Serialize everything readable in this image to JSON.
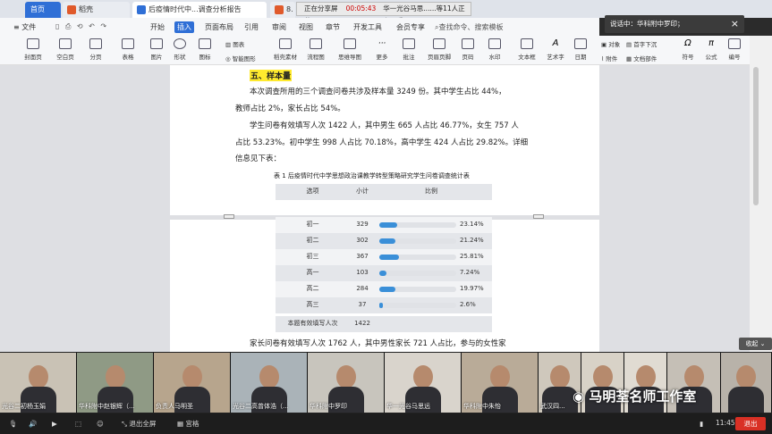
{
  "tabs": [
    {
      "label": "首页",
      "color": "#2f6fd6",
      "active": false
    },
    {
      "label": "稻壳",
      "color": "#e05a2b",
      "active": false
    },
    {
      "label": "后疫情时代中...调查分析报告",
      "color": "#2f6fd6",
      "active": true
    },
    {
      "label": "8.",
      "color": "#e05a2b",
      "active": false
    }
  ],
  "share_status": {
    "label": "正在分享屏幕",
    "time": "00:05:43",
    "viewers": "华一光谷马思......等11人正在观看"
  },
  "popup": {
    "text": "说话中：华科附中罗印；",
    "close": "×"
  },
  "menu": [
    "文件",
    "开始",
    "插入",
    "页面布局",
    "引用",
    "审阅",
    "视图",
    "章节",
    "开发工具",
    "会员专享"
  ],
  "menu_active_index": 2,
  "search_label": "查找命令、搜索模板",
  "ribbon": [
    "封面页",
    "空白页",
    "分页",
    "表格",
    "图片",
    "形状",
    "图标",
    "智能图形",
    "稻壳素材",
    "流程图",
    "思维导图",
    "更多",
    "批注",
    "页眉页脚",
    "页码",
    "水印",
    "文本框",
    "艺术字",
    "日期",
    "附件",
    "文档部件",
    "符号",
    "公式",
    "编号"
  ],
  "ribbon_small": {
    "chart": "图表",
    "object": "对象",
    "dropcap": "首字下沉"
  },
  "document": {
    "heading": "五、样本量",
    "para1_line1": "本次调查所用的三个调查问卷共涉及样本量 3249 份。其中学生占比 44%，",
    "para1_line2": "教师占比 2%，家长占比 54%。",
    "para2_line1": "学生问卷有效填写人次 1422 人，其中男生 665 人占比 46.77%，女生 757 人",
    "para2_line2": "占比 53.23%。初中学生 998 人占比 70.18%，高中学生 424 人占比 29.82%。详细",
    "para2_line3": "信息见下表：",
    "caption": "表 1   后疫情时代中学思想政治课教学转型策略研究学生问卷调查统计表",
    "para3": "家长问卷有效填写人次 1762 人，其中男性家长 721 人占比，参与的女性家"
  },
  "table": {
    "headers": [
      "选项",
      "小计",
      "比例"
    ],
    "rows": [
      {
        "option": "初一",
        "count": "329",
        "pct": "23.14%",
        "ratio": 0.2314
      },
      {
        "option": "初二",
        "count": "302",
        "pct": "21.24%",
        "ratio": 0.2124
      },
      {
        "option": "初三",
        "count": "367",
        "pct": "25.81%",
        "ratio": 0.2581
      },
      {
        "option": "高一",
        "count": "103",
        "pct": "7.24%",
        "ratio": 0.0724
      },
      {
        "option": "高二",
        "count": "284",
        "pct": "19.97%",
        "ratio": 0.1997
      },
      {
        "option": "高三",
        "count": "37",
        "pct": "2.6%",
        "ratio": 0.026
      }
    ],
    "footer_label": "本题有效填写人次",
    "footer_value": "1422"
  },
  "collapse_label": "收起",
  "participants": [
    "光谷二初杨玉娟",
    "华科附中赵银辉（...",
    "负责人马明圣",
    "光谷二高曾体浩（...",
    "华科附中罗印",
    "华一光谷马思远",
    "华科附中朱怡",
    "武汉四...",
    "",
    "",
    ""
  ],
  "watermark": "马明荃名师工作室",
  "controls": {
    "exit_fullscreen": "退出全屏",
    "grid": "宫格",
    "time": "11:45",
    "leave": "退出"
  },
  "accent": "#2f6fd6"
}
